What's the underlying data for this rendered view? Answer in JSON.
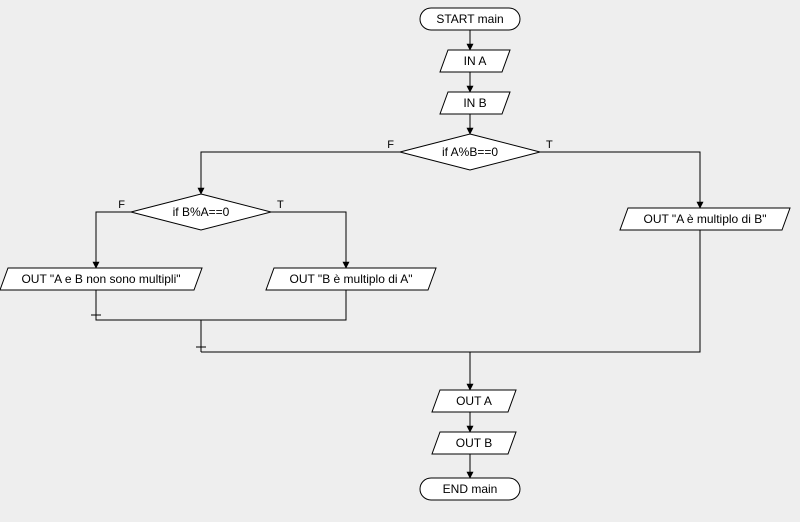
{
  "nodes": {
    "start": "START main",
    "in_a": "IN A",
    "in_b": "IN B",
    "dec1": "if A%B==0",
    "dec2": "if B%A==0",
    "out_mult_b": "OUT \"A è multiplo di B\"",
    "out_mult_a": "OUT \"B è multiplo di A\"",
    "out_non": "OUT \"A e B non sono multipli\"",
    "out_a": "OUT A",
    "out_b": "OUT B",
    "end": "END main"
  },
  "labels": {
    "true": "T",
    "false": "F"
  },
  "chart_data": {
    "type": "flowchart",
    "title": "",
    "nodes": [
      {
        "id": "start",
        "shape": "terminator",
        "text": "START main"
      },
      {
        "id": "in_a",
        "shape": "io",
        "text": "IN A"
      },
      {
        "id": "in_b",
        "shape": "io",
        "text": "IN B"
      },
      {
        "id": "dec1",
        "shape": "decision",
        "text": "if A%B==0"
      },
      {
        "id": "dec2",
        "shape": "decision",
        "text": "if B%A==0"
      },
      {
        "id": "out_mult_b",
        "shape": "io",
        "text": "OUT \"A è multiplo di B\""
      },
      {
        "id": "out_mult_a",
        "shape": "io",
        "text": "OUT \"B è multiplo di A\""
      },
      {
        "id": "out_non",
        "shape": "io",
        "text": "OUT \"A e B non sono multipli\""
      },
      {
        "id": "out_a",
        "shape": "io",
        "text": "OUT A"
      },
      {
        "id": "out_b",
        "shape": "io",
        "text": "OUT B"
      },
      {
        "id": "end",
        "shape": "terminator",
        "text": "END main"
      }
    ],
    "edges": [
      {
        "from": "start",
        "to": "in_a"
      },
      {
        "from": "in_a",
        "to": "in_b"
      },
      {
        "from": "in_b",
        "to": "dec1"
      },
      {
        "from": "dec1",
        "to": "out_mult_b",
        "label": "T"
      },
      {
        "from": "dec1",
        "to": "dec2",
        "label": "F"
      },
      {
        "from": "dec2",
        "to": "out_mult_a",
        "label": "T"
      },
      {
        "from": "dec2",
        "to": "out_non",
        "label": "F"
      },
      {
        "from": "out_mult_b",
        "to": "out_a"
      },
      {
        "from": "out_mult_a",
        "to": "out_a"
      },
      {
        "from": "out_non",
        "to": "out_a"
      },
      {
        "from": "out_a",
        "to": "out_b"
      },
      {
        "from": "out_b",
        "to": "end"
      }
    ]
  }
}
